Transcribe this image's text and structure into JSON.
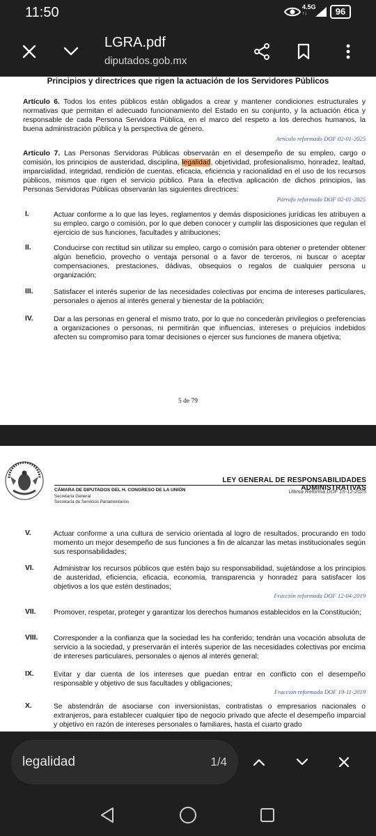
{
  "status_bar": {
    "time": "11:50",
    "network": "4.5G",
    "network_sub": "↑↓",
    "battery": "96"
  },
  "app_bar": {
    "title": "LGRA.pdf",
    "subtitle": "diputados.gob.mx"
  },
  "page1": {
    "title": "Principios y directrices que rigen la actuación de los Servidores Públicos",
    "art6_label": "Artículo 6.",
    "art6_text": " Todos los entes públicos están obligados a crear y mantener condiciones estructurales y normativas que permitan el adecuado funcionamiento del Estado en su conjunto, y la actuación ética y responsable de cada Persona Servidora Pública, en el marco del respeto a los derechos humanos, la buena administración pública y la perspectiva de género.",
    "art6_reform": "Artículo reformado DOF 02-01-2025",
    "art7_label": "Artículo 7.",
    "art7_before": " Las Personas Servidoras Públicas observarán en el desempeño de su empleo, cargo o comisión, los principios de austeridad, disciplina, ",
    "art7_highlight": "legalidad",
    "art7_after": ", objetividad, profesionalismo, honradez, lealtad, imparcialidad, integridad, rendición de cuentas, eficacia, eficiencia y racionalidad en el uso de los recursos públicos, mismos que rigen el servicio público. Para la efectiva aplicación de dichos principios, las Personas Servidoras Públicas observarán las siguientes directrices:",
    "art7_reform": "Párrafo reformado DOF 02-01-2025",
    "items": [
      {
        "num": "I.",
        "text": "Actuar conforme a lo que las leyes, reglamentos y demás disposiciones jurídicas les atribuyen a su empleo, cargo o comisión, por lo que deben conocer y cumplir las disposiciones que regulan el ejercicio de sus funciones, facultades y atribuciones;"
      },
      {
        "num": "II.",
        "text": "Conducirse con rectitud sin utilizar su empleo, cargo o comisión para obtener o pretender obtener algún beneficio, provecho o ventaja personal o a favor de terceros, ni buscar o aceptar compensaciones, prestaciones, dádivas, obsequios o regalos de cualquier persona u organización;"
      },
      {
        "num": "III.",
        "text": "Satisfacer el interés superior de las necesidades colectivas por encima de intereses particulares, personales o ajenos al interés general y bienestar de la población;"
      },
      {
        "num": "IV.",
        "text": "Dar a las personas en general el mismo trato, por lo que no concederán privilegios o preferencias a organizaciones o personas, ni permitirán que influencias, intereses o prejuicios indebidos afecten su compromiso para tomar decisiones o ejercer sus funciones de manera objetiva;"
      }
    ],
    "page_number": "5 de 79"
  },
  "page2": {
    "law_title": "LEY GENERAL DE RESPONSABILIDADES ADMINISTRATIVAS",
    "camara": "CÁMARA DE DIPUTADOS DEL H. CONGRESO DE LA UNIÓN",
    "secretaria_general": "Secretaría General",
    "secretaria_servicios": "Secretaría de Servicios Parlamentarios",
    "ultima_reforma": "Última Reforma DOF 15-12-2025",
    "items": [
      {
        "num": "V.",
        "text": "Actuar conforme a una cultura de servicio orientada al logro de resultados, procurando en todo momento un mejor desempeño de sus funciones a fin de alcanzar las metas institucionales según sus responsabilidades;",
        "reform": ""
      },
      {
        "num": "VI.",
        "text": "Administrar los recursos públicos que estén bajo su responsabilidad, sujetándose a los principios de austeridad, eficiencia, eficacia, economía, transparencia y honradez para satisfacer los objetivos a los que estén destinados;",
        "reform": "Fracción reformada DOF 12-04-2019"
      },
      {
        "num": "VII.",
        "text": "Promover, respetar, proteger y garantizar los derechos humanos establecidos en la Constitución;",
        "reform": ""
      },
      {
        "num": "VIII.",
        "text": "Corresponder a la confianza que la sociedad les ha conferido; tendrán una vocación absoluta de servicio a la sociedad, y preservarán el interés superior de las necesidades colectivas por encima de intereses particulares, personales o ajenos al interés general;",
        "reform": ""
      },
      {
        "num": "IX.",
        "text": "Evitar y dar cuenta de los intereses que puedan entrar en conflicto con el desempeño responsable y objetivo de sus facultades y obligaciones;",
        "reform": "Fracción reformada DOF 19-11-2019"
      },
      {
        "num": "X.",
        "text": "Se abstendrán de asociarse con inversionistas, contratistas o empresarios nacionales o extranjeros, para establecer cualquier tipo de negocio privado que afecte el desempeño imparcial y objetivo en razón de intereses personales o familiares, hasta el cuarto grado",
        "reform": ""
      }
    ]
  },
  "find_bar": {
    "query": "legalidad",
    "count": "1/4"
  },
  "colors": {
    "background": "#1f1f1f",
    "highlight": "#f3a76a",
    "reform_text": "#3355aa"
  }
}
